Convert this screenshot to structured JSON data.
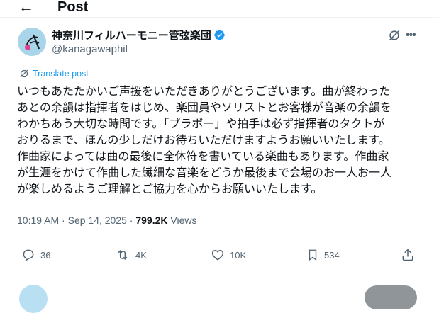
{
  "header": {
    "title": "Post"
  },
  "author": {
    "name": "神奈川フィルハーモニー管弦楽団",
    "handle": "@kanagawaphil"
  },
  "translate_label": "Translate post",
  "post_lines": [
    "いつもあたたかいご声援をいただきありがとうございます。曲が終わった",
    "あとの余韻は指揮者をはじめ、楽団員やソリストとお客様が音楽の余韻を",
    "わかちあう大切な時間です。「ブラボー」や拍手は必ず指揮者のタクトが",
    "おりるまで、ほんの少しだけお待ちいただけますようお願いいたします。",
    "作曲家によっては曲の最後に全休符を書いている楽曲もあります。作曲家",
    "が生涯をかけて作曲した繊細な音楽をどうか最後まで会場のお一人お一人",
    "が楽しめるようご理解とご協力を心からお願いいたします。"
  ],
  "meta": {
    "time": "10:19 AM",
    "separator": "·",
    "date": "Sep 14, 2025",
    "views_count": "799.2K",
    "views_label": "Views"
  },
  "actions": {
    "replies": "36",
    "reposts": "4K",
    "likes": "10K",
    "bookmarks": "534"
  },
  "icons": [
    "back-arrow-icon",
    "verified-icon",
    "grok-icon",
    "more-icon",
    "translate-icon",
    "reply-icon",
    "repost-icon",
    "like-icon",
    "bookmark-icon",
    "share-icon"
  ],
  "colors": {
    "accent": "#1d9bf0",
    "text": "#0f1419",
    "muted": "#536471",
    "verified": "#1d9bf0"
  }
}
